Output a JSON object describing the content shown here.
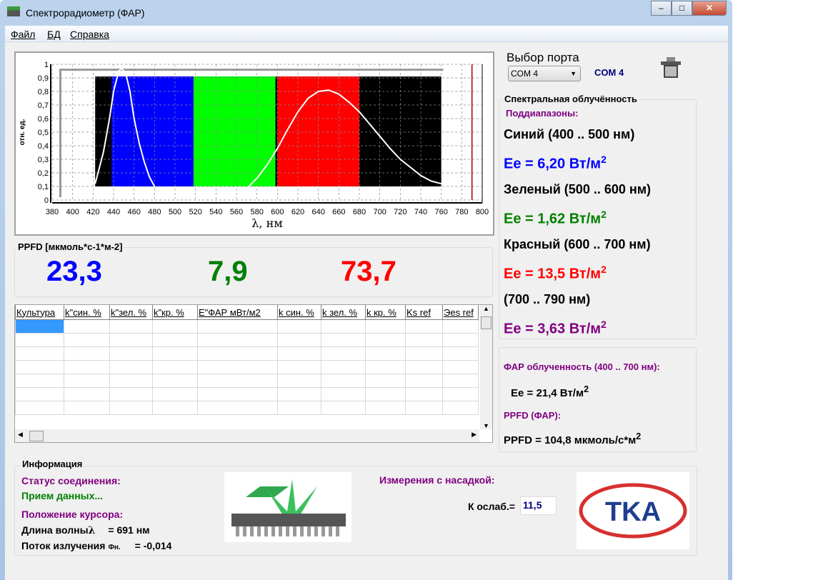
{
  "window": {
    "title": "Спектрорадиометр (ФАР)",
    "minimize": "–",
    "maximize": "□",
    "close": "✕"
  },
  "menu": [
    "Файл",
    "БД",
    "Справка"
  ],
  "chart_data": {
    "type": "line",
    "ylabel": "отн. ед.",
    "xlabel": "λ, нм",
    "xlim": [
      380,
      800
    ],
    "ylim": [
      0,
      1
    ],
    "xticks": [
      380,
      400,
      420,
      440,
      460,
      480,
      500,
      520,
      540,
      560,
      580,
      600,
      620,
      640,
      660,
      680,
      700,
      720,
      740,
      760,
      780,
      800
    ],
    "yticks": [
      0,
      0.1,
      0.2,
      0.3,
      0.4,
      0.5,
      0.6,
      0.7,
      0.8,
      0.9,
      1
    ],
    "ytick_labels": [
      "0",
      "0,1",
      "0,2",
      "0,3",
      "0,4",
      "0,5",
      "0,6",
      "0,7",
      "0,8",
      "0,9",
      "1"
    ],
    "bands": [
      {
        "name": "background",
        "from": 422,
        "to": 760,
        "color": "#000000"
      },
      {
        "name": "blue",
        "from": 438,
        "to": 518,
        "color": "#0000ff"
      },
      {
        "name": "green",
        "from": 518,
        "to": 598,
        "color": "#00ff00"
      },
      {
        "name": "red",
        "from": 600,
        "to": 680,
        "color": "#ff0000"
      }
    ],
    "band_ylim": [
      0.1,
      0.91
    ],
    "cursor_x": 790,
    "series": [
      {
        "name": "blue-peak",
        "x": [
          422,
          430,
          436,
          440,
          445,
          448,
          452,
          456,
          460,
          465,
          470,
          475,
          480
        ],
        "y": [
          0.12,
          0.35,
          0.6,
          0.8,
          0.95,
          0.97,
          0.93,
          0.8,
          0.6,
          0.42,
          0.28,
          0.17,
          0.1
        ]
      },
      {
        "name": "red-peak",
        "x": [
          572,
          580,
          590,
          600,
          610,
          620,
          630,
          640,
          650,
          660,
          670,
          680,
          690,
          700,
          710,
          720,
          730,
          740,
          750,
          760
        ],
        "y": [
          0.1,
          0.16,
          0.26,
          0.38,
          0.52,
          0.65,
          0.75,
          0.8,
          0.81,
          0.78,
          0.72,
          0.65,
          0.56,
          0.47,
          0.38,
          0.3,
          0.24,
          0.18,
          0.14,
          0.12
        ]
      }
    ]
  },
  "port": {
    "label": "Выбор порта",
    "selected": "COM 4",
    "status": "COM  4"
  },
  "spectral": {
    "title": "Спектральная облучённость",
    "sub": "Поддиапазоны:",
    "bands": [
      {
        "name": "Синий (400 .. 500 нм)",
        "value": "Ee = 6,20 Вт/м",
        "color": "#0000ff"
      },
      {
        "name": "Зеленый (500 .. 600 нм)",
        "value": "Ee = 1,62 Вт/м",
        "color": "#008000"
      },
      {
        "name": "Красный (600 .. 700 нм)",
        "value": "Ee = 13,5  Вт/м",
        "color": "#ff0000"
      },
      {
        "name": "(700 .. 790 нм)",
        "value": "Ee = 3,63 Вт/м",
        "color": "#800080"
      }
    ],
    "sup": "2"
  },
  "far": {
    "title": "ФАР облученность (400 .. 700 нм):",
    "ee": "Ee = 21,4  Вт/м",
    "ppfd_title": "PPFD (ФАР):",
    "ppfd": "PPFD = 104,8 мкмоль/с*м",
    "sup": "2"
  },
  "ppfd": {
    "label": "PPFD [мкмоль*с-1*м-2]",
    "blue": "23,3",
    "green": "7,9",
    "red": "73,7"
  },
  "table": {
    "columns": [
      "Культура",
      "k\"син. %",
      "k\"зел. %",
      "k\"кр. %",
      "E\"ФАР мВт/м2",
      "k син. %",
      "k зел. %",
      "k кр. %",
      "Ks ref",
      "Эes ref"
    ]
  },
  "info": {
    "title": "Информация",
    "status_label": "Статус соединения:",
    "status": "Прием данных...",
    "cursor_label": "Положение курсора:",
    "wl_label": "Длина волны",
    "wl_sym": "λ",
    "wl_value": "= 691 нм",
    "flux_label": "Поток излучения",
    "flux_sym": "Фн.",
    "flux_value": "= -0,014",
    "nozzle_label": "Измерения с насадкой:",
    "k_label": "К ослаб.=",
    "k_value": "11,5",
    "logo_text": "ТКА"
  }
}
